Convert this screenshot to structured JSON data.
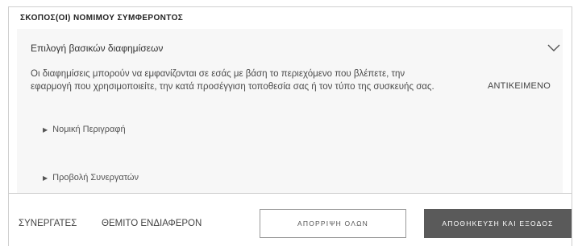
{
  "section": {
    "title": "ΣΚΟΠΟΣ(ΟΙ) ΝΟΜΙΜΟΥ ΣΥΜΦΕΡΟΝΤΟΣ"
  },
  "purpose": {
    "title": "Επιλογή βασικών διαφημίσεων",
    "description": "Οι διαφημίσεις μπορούν να εμφανίζονται σε εσάς με βάση το περιεχόμενο που βλέπετε, την εφαρμογή που χρησιμοποιείτε, την κατά προσέγγιση τοποθεσία σας ή τον τύπο της συσκευής σας.",
    "tag": "ΑΝΤΙΚΕΙΜΕΝΟ",
    "chevron_icon": "chevron-down-icon",
    "expanders": {
      "legal": "Νομική Περιγραφή",
      "partners": "Προβολή Συνεργατών"
    }
  },
  "footer": {
    "partners_link": "ΣΥΝΕΡΓΑΤΕΣ",
    "legit_interest_link": "ΘΕΜΙΤΟ ΕΝΔΙΑΦΕΡΟΝ",
    "reject_all_button": "ΑΠΟΡΡΙΨΗ ΟΛΩΝ",
    "save_exit_button": "ΑΠΟΘΗΚΕΥΣΗ ΚΑΙ ΕΞΟΔΟΣ"
  },
  "colors": {
    "card_background": "#f7f7f7",
    "primary_button": "#5a5a5a",
    "border": "#cfcfcf"
  }
}
